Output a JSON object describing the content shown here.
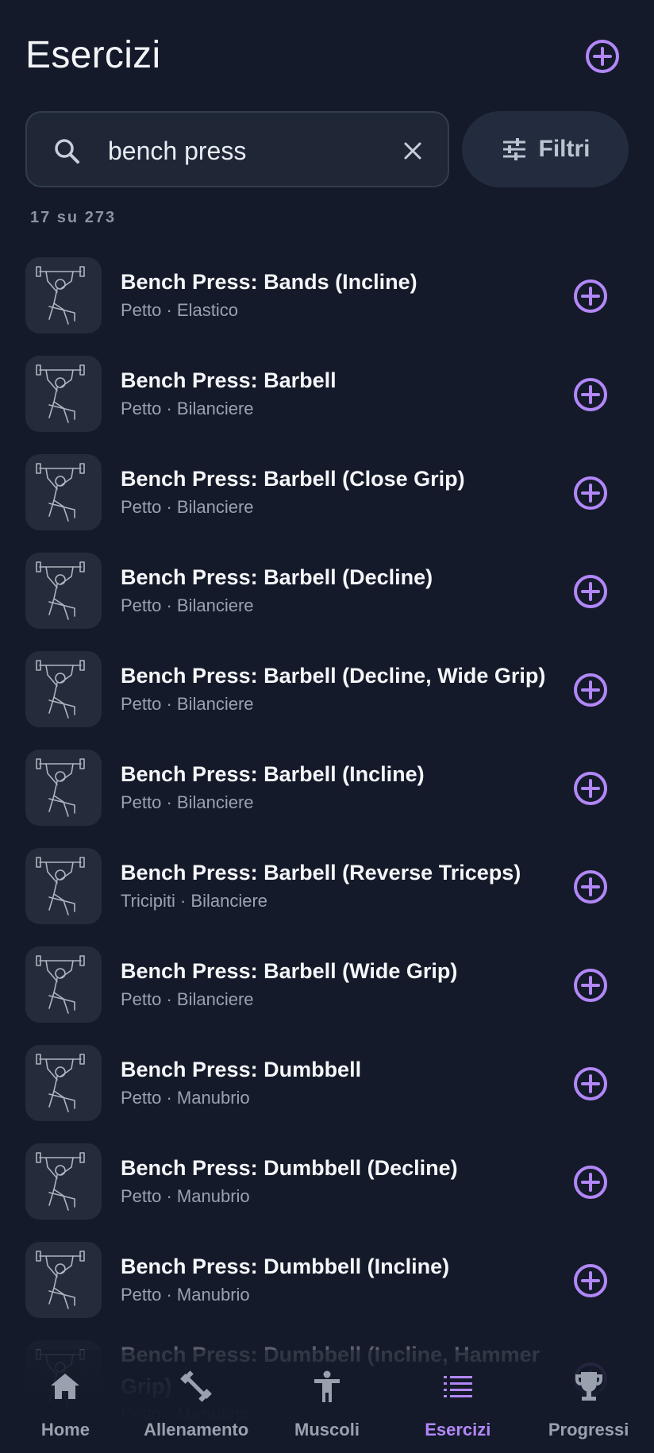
{
  "header": {
    "title": "Esercizi"
  },
  "search": {
    "value": "bench press"
  },
  "filter": {
    "label": "Filtri"
  },
  "count": "17 su 273",
  "colors": {
    "accent": "#b287f8",
    "background": "#141a29",
    "card": "#242c3b"
  },
  "exercises": [
    {
      "title": "Bench Press: Bands (Incline)",
      "subtitle": "Petto · Elastico"
    },
    {
      "title": "Bench Press: Barbell",
      "subtitle": "Petto · Bilanciere"
    },
    {
      "title": "Bench Press: Barbell (Close Grip)",
      "subtitle": "Petto · Bilanciere"
    },
    {
      "title": "Bench Press: Barbell (Decline)",
      "subtitle": "Petto · Bilanciere"
    },
    {
      "title": "Bench Press: Barbell (Decline, Wide Grip)",
      "subtitle": "Petto · Bilanciere"
    },
    {
      "title": "Bench Press: Barbell (Incline)",
      "subtitle": "Petto · Bilanciere"
    },
    {
      "title": "Bench Press: Barbell (Reverse Triceps)",
      "subtitle": "Tricipiti · Bilanciere"
    },
    {
      "title": "Bench Press: Barbell (Wide Grip)",
      "subtitle": "Petto · Bilanciere"
    },
    {
      "title": "Bench Press: Dumbbell",
      "subtitle": "Petto · Manubrio"
    },
    {
      "title": "Bench Press: Dumbbell (Decline)",
      "subtitle": "Petto · Manubrio"
    },
    {
      "title": "Bench Press: Dumbbell (Incline)",
      "subtitle": "Petto · Manubrio"
    },
    {
      "title": "Bench Press: Dumbbell (Incline, Hammer Grip)",
      "subtitle": "Petto · Manubrio"
    }
  ],
  "nav": [
    {
      "label": "Home",
      "icon": "home-icon"
    },
    {
      "label": "Allenamento",
      "icon": "dumbbell-icon"
    },
    {
      "label": "Muscoli",
      "icon": "body-icon"
    },
    {
      "label": "Esercizi",
      "icon": "list-icon",
      "active": true
    },
    {
      "label": "Progressi",
      "icon": "trophy-icon"
    }
  ]
}
